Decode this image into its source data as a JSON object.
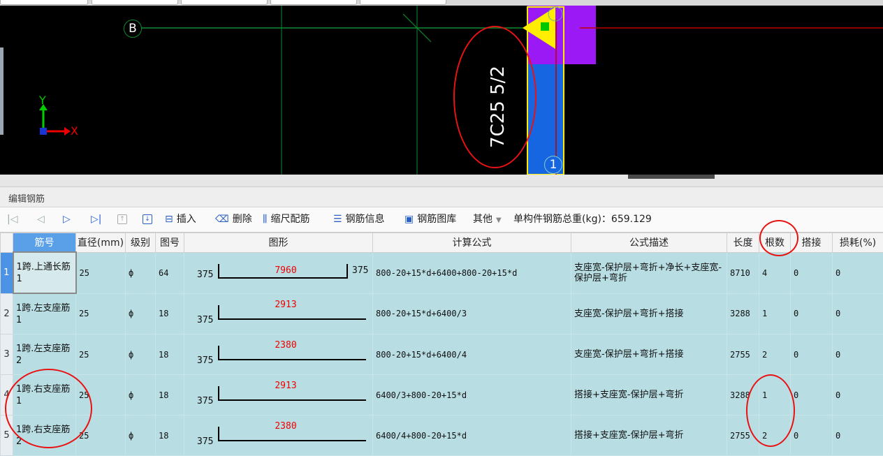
{
  "viewport": {
    "axis_b": "B",
    "axis_1": "1",
    "axis_x": "X",
    "axis_y": "Y",
    "rebar_label": "7C25 5/2",
    "colors": {
      "background": "#000000",
      "grid": "#0c8a2c",
      "column": "#1566e0",
      "support": "#9b19f5",
      "marker": "#ffee00",
      "beam_line": "#c00000"
    }
  },
  "panel": {
    "title": "编辑钢筋"
  },
  "toolbar": {
    "nav_first_icon": "first-icon",
    "insert": "插入",
    "delete": "删除",
    "scale": "缩尺配筋",
    "info": "钢筋信息",
    "library": "钢筋图库",
    "other": "其他",
    "total_weight": "单构件钢筋总重(kg)：659.129"
  },
  "table": {
    "headers": [
      "筋号",
      "直径(mm)",
      "级别",
      "图号",
      "图形",
      "计算公式",
      "公式描述",
      "长度",
      "根数",
      "搭接",
      "损耗(%)"
    ],
    "rows": [
      {
        "idx": "1",
        "name": "1跨.上通长筋1",
        "dia": "25",
        "grade": "ф",
        "fig": "64",
        "shape_l": "375",
        "shape_m": "7960",
        "shape_r": "375",
        "formula": "800-20+15*d+6400+800-20+15*d",
        "desc": "支座宽-保护层+弯折+净长+支座宽-保护层+弯折",
        "len": "8710",
        "count": "4",
        "lap": "0",
        "loss": "0"
      },
      {
        "idx": "2",
        "name": "1跨.左支座筋1",
        "dia": "25",
        "grade": "ф",
        "fig": "18",
        "shape_l": "375",
        "shape_m": "2913",
        "formula": "800-20+15*d+6400/3",
        "desc": "支座宽-保护层+弯折+搭接",
        "len": "3288",
        "count": "1",
        "lap": "0",
        "loss": "0"
      },
      {
        "idx": "3",
        "name": "1跨.左支座筋2",
        "dia": "25",
        "grade": "ф",
        "fig": "18",
        "shape_l": "375",
        "shape_m": "2380",
        "formula": "800-20+15*d+6400/4",
        "desc": "支座宽-保护层+弯折+搭接",
        "len": "2755",
        "count": "2",
        "lap": "0",
        "loss": "0"
      },
      {
        "idx": "4",
        "name": "1跨.右支座筋1",
        "dia": "25",
        "grade": "ф",
        "fig": "18",
        "shape_l": "375",
        "shape_m": "2913",
        "formula": "6400/3+800-20+15*d",
        "desc": "搭接+支座宽-保护层+弯折",
        "len": "3288",
        "count": "1",
        "lap": "0",
        "loss": "0"
      },
      {
        "idx": "5",
        "name": "1跨.右支座筋2",
        "dia": "25",
        "grade": "ф",
        "fig": "18",
        "shape_l": "375",
        "shape_m": "2380",
        "formula": "6400/4+800-20+15*d",
        "desc": "搭接+支座宽-保护层+弯折",
        "len": "2755",
        "count": "2",
        "lap": "0",
        "loss": "0"
      }
    ]
  }
}
